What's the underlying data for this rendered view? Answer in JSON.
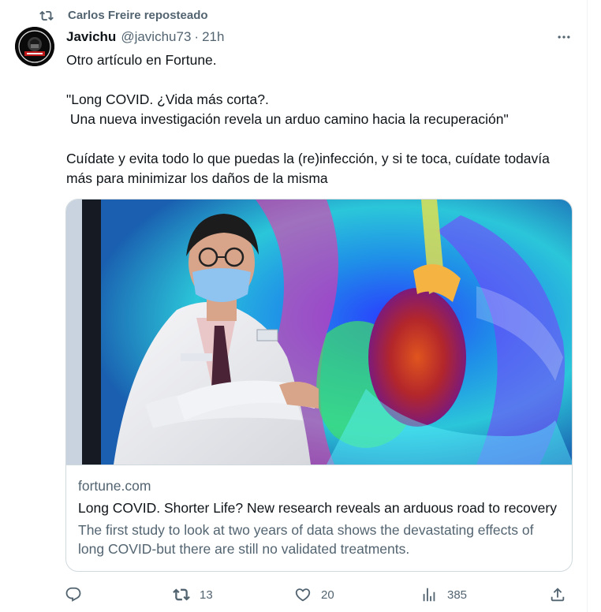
{
  "repost": {
    "label": "Carlos Freire reposteado"
  },
  "post": {
    "author_name": "Javichu",
    "author_handle": "@javichu73",
    "separator": "·",
    "time": "21h",
    "paragraphs": [
      "Otro artículo en Fortune.",
      "\"Long COVID. ¿Vida más corta?.\n Una nueva investigación revela un arduo camino hacia la recuperación\"",
      "Cuídate y evita todo lo que puedas la (re)infección, y si te toca, cuídate todavía más para minimizar los daños de la misma"
    ]
  },
  "card": {
    "domain": "fortune.com",
    "title": "Long COVID. Shorter Life? New research reveals an arduous road to recovery",
    "description": "The first study to look at two years of data shows the devastating effects of long COVID-but there are still no validated treatments."
  },
  "actions": {
    "reply_count": "",
    "repost_count": "13",
    "like_count": "20",
    "views_count": "385"
  },
  "icons": {
    "repost": "repost-icon",
    "more": "more-icon",
    "reply": "reply-icon",
    "like": "heart-icon",
    "views": "views-icon",
    "share": "share-icon"
  },
  "colors": {
    "text_primary": "#0f1419",
    "text_secondary": "#536471",
    "border": "#cfd9de"
  }
}
